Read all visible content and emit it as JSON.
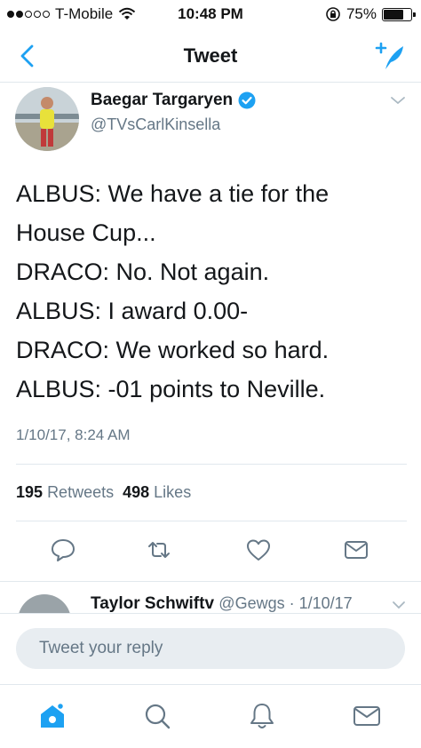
{
  "status_bar": {
    "carrier": "T-Mobile",
    "time": "10:48 PM",
    "battery": "75%",
    "battery_level": 0.75
  },
  "nav": {
    "title": "Tweet"
  },
  "tweet": {
    "author_name": "Baegar Targaryen",
    "author_handle": "@TVsCarlKinsella",
    "lines": [
      "ALBUS: We have a tie for the",
      "House Cup...",
      "DRACO: No. Not again.",
      "ALBUS: I award 0.00-",
      "DRACO: We worked so hard.",
      "ALBUS: -01 points to Neville."
    ],
    "timestamp": "1/10/17, 8:24 AM",
    "retweets_count": "195",
    "retweets_label": "Retweets",
    "likes_count": "498",
    "likes_label": "Likes"
  },
  "reply": {
    "name": "Taylor Schwiftv",
    "meta": "@Gewgs · 1/10/17"
  },
  "reply_box": {
    "placeholder": "Tweet your reply"
  },
  "colors": {
    "accent": "#1da1f2",
    "secondary_text": "#657786",
    "divider": "#e1e8ed"
  },
  "icons": [
    "back-chevron-icon",
    "compose-tweet-icon",
    "verified-badge-icon",
    "chevron-down-icon",
    "reply-icon",
    "retweet-icon",
    "like-heart-icon",
    "direct-message-icon",
    "home-icon",
    "search-icon",
    "notifications-bell-icon",
    "messages-envelope-icon"
  ]
}
